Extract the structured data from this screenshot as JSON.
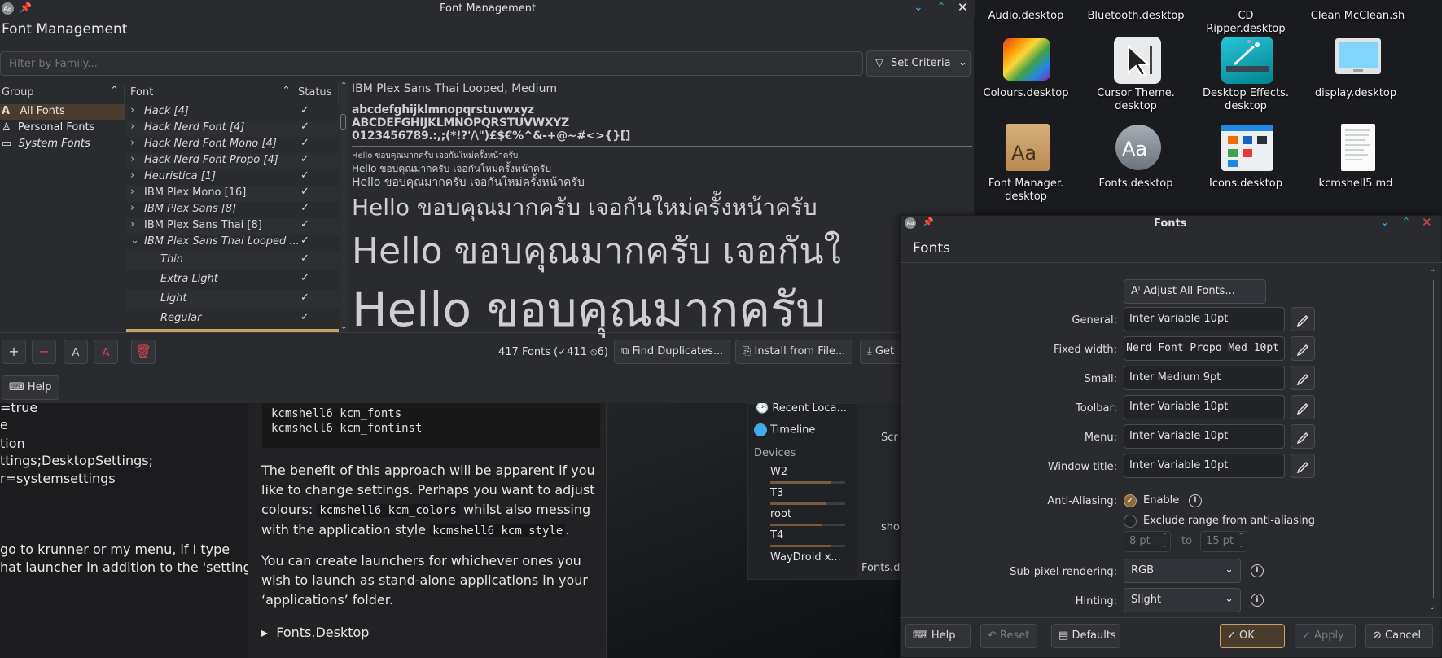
{
  "background_doc": {
    "lines": [
      "=true",
      "e",
      "tion",
      "ttings;DesktopSettings;",
      "r=systemsettings",
      "go to krunner or my menu, if I type",
      "hat launcher in addition to the 'settings'"
    ]
  },
  "article": {
    "code_lines": [
      "kcmshell6 kcm_fonts",
      "kcmshell6 kcm_fontinst"
    ],
    "para1": "The benefit of this approach will be apparent if you like to change settings. Perhaps you want to adjust colours:",
    "para1_code1": "kcmshell6 kcm_colors",
    "para1_mid": " whilst also messing with the application style ",
    "para1_code2": "kcmshell6 kcm_style",
    "para1_end": ".",
    "para2": "You can create launchers for whichever ones you wish to launch as stand-alone applications in your ‘applications’ folder.",
    "details": "Fonts.Desktop"
  },
  "dolphin": {
    "places": [
      {
        "label": "Recent Loca..."
      },
      {
        "label": "Timeline"
      }
    ],
    "devices_heading": "Devices",
    "devices": [
      {
        "label": "W2",
        "usage": 0.8
      },
      {
        "label": "T3",
        "usage": 0.75
      },
      {
        "label": "root",
        "usage": 0.7
      },
      {
        "label": "T4",
        "usage": 0.8
      },
      {
        "label": "WayDroid x...",
        "usage": 0
      }
    ],
    "side_texts": [
      "Scr",
      "sho",
      "Fonts.d"
    ]
  },
  "desktop_icons": [
    {
      "label": "Audio.desktop"
    },
    {
      "label": "Bluetooth.desktop"
    },
    {
      "label": "CD Ripper.desktop"
    },
    {
      "label": "Clean McClean.sh"
    },
    {
      "label": "Colours.desktop"
    },
    {
      "label": "Cursor Theme. desktop"
    },
    {
      "label": "Desktop Effects. desktop"
    },
    {
      "label": "display.desktop"
    },
    {
      "label": "Font Manager. desktop"
    },
    {
      "label": "Fonts.desktop"
    },
    {
      "label": "Icons.desktop"
    },
    {
      "label": "kcmshell5.md"
    }
  ],
  "font_manager": {
    "window_title": "Font Management",
    "heading": "Font Management",
    "filter_placeholder": "Filter by Family...",
    "set_criteria": "Set Criteria",
    "columns": {
      "group": "Group",
      "font": "Font",
      "status": "Status"
    },
    "groups": [
      "All Fonts",
      "Personal Fonts",
      "System Fonts"
    ],
    "fonts": [
      {
        "name": "Hack [4]",
        "expander": "›",
        "status": "✓"
      },
      {
        "name": "Hack Nerd Font [4]",
        "expander": "›",
        "status": "✓"
      },
      {
        "name": "Hack Nerd Font Mono [4]",
        "expander": "›",
        "status": "✓"
      },
      {
        "name": "Hack Nerd Font Propo [4]",
        "expander": "›",
        "status": "✓"
      },
      {
        "name": "Heuristica [1]",
        "expander": "›",
        "status": "✓"
      },
      {
        "name": "IBM Plex Mono [16]",
        "expander": "›",
        "status": "✓"
      },
      {
        "name": "IBM Plex Sans [8]",
        "expander": "›",
        "status": "✓"
      },
      {
        "name": "IBM Plex Sans Thai [8]",
        "expander": "›",
        "status": "✓"
      },
      {
        "name": "IBM Plex Sans Thai Looped ...",
        "expander": "⌄",
        "status": "✓"
      }
    ],
    "styles": [
      {
        "name": "Thin",
        "status": "✓"
      },
      {
        "name": "Extra Light",
        "status": "✓"
      },
      {
        "name": "Light",
        "status": "✓"
      },
      {
        "name": "Regular",
        "status": "✓"
      }
    ],
    "preview": {
      "font_name": "IBM Plex Sans Thai Looped, Medium",
      "lower": "abcdefghijklmnopqrstuvwxyz",
      "upper": "ABCDEFGHIJKLMNOPQRSTUVWXYZ",
      "digits": "0123456789.:,;(*!?'/\\\")£$€%^&-+@~#<>{}[]",
      "sample_full": "Hello ขอบคุณมากครับ เจอกันใหม่ครั้งหน้าครับ",
      "sample_mid": "Hello ขอบคุณมากครับ เจอกันใ",
      "sample_big": "Hello ขอบคุณมากครับ"
    },
    "summary": {
      "total": "417 Fonts (",
      "enabled": "411",
      "disabled": "6)"
    },
    "find_duplicates": "Find Duplicates...",
    "install_from_file": "Install from File...",
    "get_new": "Get",
    "help": "Help"
  },
  "fonts_dialog": {
    "window_title": "Fonts",
    "heading": "Fonts",
    "adjust_all": "Adjust All Fonts...",
    "rows": [
      {
        "label": "General:",
        "value": "Inter Variable 10pt"
      },
      {
        "label": "Fixed width:",
        "value": "Nerd Font Propo Med 10pt"
      },
      {
        "label": "Small:",
        "value": "Inter Medium 9pt"
      },
      {
        "label": "Toolbar:",
        "value": "Inter Variable 10pt"
      },
      {
        "label": "Menu:",
        "value": "Inter Variable 10pt"
      },
      {
        "label": "Window title:",
        "value": "Inter Variable 10pt"
      }
    ],
    "antialiasing_label": "Anti-Aliasing:",
    "enable": "Enable",
    "exclude_range": "Exclude range from anti-aliasing",
    "range_from": "8 pt",
    "range_to_label": "to",
    "range_to": "15 pt",
    "subpixel_label": "Sub-pixel rendering:",
    "subpixel_value": "RGB",
    "hinting_label": "Hinting:",
    "hinting_value": "Slight",
    "buttons": {
      "help": "Help",
      "reset": "Reset",
      "defaults": "Defaults",
      "ok": "OK",
      "apply": "Apply",
      "cancel": "Cancel"
    }
  },
  "colors": {
    "accent": "#c9a36b",
    "selected_row": "#4a3d2e",
    "close_red": "#da4453",
    "maximize_green": "#27ae60",
    "minimize_blue": "#3daee9"
  }
}
